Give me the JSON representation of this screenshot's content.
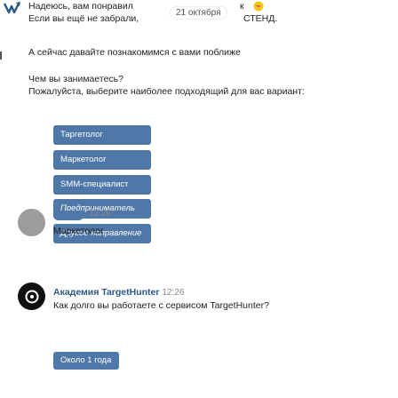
{
  "top_message": {
    "line1": "Надеюсь, вам понравил",
    "line1_tail": "к",
    "line2": "Если вы ещё не забрали, ",
    "line2_tail": "СТЕНД.",
    "date": "21 октября"
  },
  "intro": "А сейчас давайте познакомимся с вами поближе",
  "question": {
    "line1": "Чем вы занимаетесь?",
    "line2": "Пожалуйста, выберите наиболее подходящий для вас вариант:"
  },
  "options": [
    "Таргетолог",
    "Маркетолог",
    "SMM-специалист",
    "Предприниматель",
    "Другое направление"
  ],
  "user_reply": {
    "time": "12:26",
    "text": "Маркетолог"
  },
  "bot_reply": {
    "author": "Академия TargetHunter",
    "time": "12:26",
    "text": "Как долго вы работаете с сервисом TargetHunter?"
  },
  "answer_button": "Около 1 года",
  "colors": {
    "button": "#4f77a8",
    "link": "#2a5885"
  },
  "icons": [
    "logo-icon",
    "heart-emoji-icon",
    "user-avatar",
    "targethunter-avatar-icon"
  ]
}
